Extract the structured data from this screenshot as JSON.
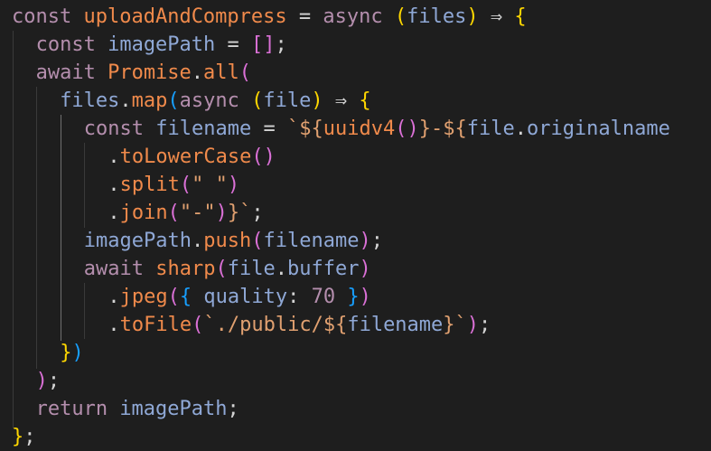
{
  "colors": {
    "background": "#1e1e1e",
    "keyword": "#b48ead",
    "function": "#f08a4b",
    "variable": "#8fa8d6",
    "punct": "#d4d4d4",
    "operator": "#d4d4d4",
    "brace_gold": "#ffd700",
    "brace_violet": "#da70d6",
    "brace_blue": "#179fff",
    "string": "#e0a070",
    "number": "#b48ead"
  },
  "code_lines": [
    [
      [
        "const ",
        "keyword"
      ],
      [
        "uploadAndCompress",
        "function"
      ],
      [
        " = ",
        "operator"
      ],
      [
        "async ",
        "keyword"
      ],
      [
        "(",
        "brace_gold"
      ],
      [
        "files",
        "variable"
      ],
      [
        ")",
        "brace_gold"
      ],
      [
        " ⇒ ",
        "operator"
      ],
      [
        "{",
        "brace_gold"
      ]
    ],
    [
      [
        "const ",
        "keyword"
      ],
      [
        "imagePath",
        "variable"
      ],
      [
        " = ",
        "operator"
      ],
      [
        "[]",
        "brace_violet"
      ],
      [
        ";",
        "punct"
      ]
    ],
    [
      [
        "await ",
        "keyword"
      ],
      [
        "Promise",
        "function"
      ],
      [
        ".",
        "punct"
      ],
      [
        "all",
        "function"
      ],
      [
        "(",
        "brace_violet"
      ]
    ],
    [
      [
        "files",
        "variable"
      ],
      [
        ".",
        "punct"
      ],
      [
        "map",
        "function"
      ],
      [
        "(",
        "brace_blue"
      ],
      [
        "async ",
        "keyword"
      ],
      [
        "(",
        "brace_gold"
      ],
      [
        "file",
        "variable"
      ],
      [
        ")",
        "brace_gold"
      ],
      [
        " ⇒ ",
        "operator"
      ],
      [
        "{",
        "brace_gold"
      ]
    ],
    [
      [
        "const ",
        "keyword"
      ],
      [
        "filename",
        "variable"
      ],
      [
        " = ",
        "operator"
      ],
      [
        "`${",
        "string"
      ],
      [
        "uuidv4",
        "function"
      ],
      [
        "()",
        "brace_violet"
      ],
      [
        "}-${",
        "string"
      ],
      [
        "file",
        "variable"
      ],
      [
        ".",
        "punct"
      ],
      [
        "originalname",
        "variable"
      ]
    ],
    [
      [
        ".",
        "punct"
      ],
      [
        "toLowerCase",
        "function"
      ],
      [
        "()",
        "brace_violet"
      ]
    ],
    [
      [
        ".",
        "punct"
      ],
      [
        "split",
        "function"
      ],
      [
        "(",
        "brace_violet"
      ],
      [
        "\" \"",
        "string"
      ],
      [
        ")",
        "brace_violet"
      ]
    ],
    [
      [
        ".",
        "punct"
      ],
      [
        "join",
        "function"
      ],
      [
        "(",
        "brace_violet"
      ],
      [
        "\"-\"",
        "string"
      ],
      [
        ")",
        "brace_violet"
      ],
      [
        "}`",
        "string"
      ],
      [
        ";",
        "punct"
      ]
    ],
    [
      [
        "imagePath",
        "variable"
      ],
      [
        ".",
        "punct"
      ],
      [
        "push",
        "function"
      ],
      [
        "(",
        "brace_violet"
      ],
      [
        "filename",
        "variable"
      ],
      [
        ")",
        "brace_violet"
      ],
      [
        ";",
        "punct"
      ]
    ],
    [
      [
        "await ",
        "keyword"
      ],
      [
        "sharp",
        "function"
      ],
      [
        "(",
        "brace_violet"
      ],
      [
        "file",
        "variable"
      ],
      [
        ".",
        "punct"
      ],
      [
        "buffer",
        "variable"
      ],
      [
        ")",
        "brace_violet"
      ]
    ],
    [
      [
        ".",
        "punct"
      ],
      [
        "jpeg",
        "function"
      ],
      [
        "(",
        "brace_violet"
      ],
      [
        "{ ",
        "brace_blue"
      ],
      [
        "quality",
        "variable"
      ],
      [
        ": ",
        "punct"
      ],
      [
        "70",
        "number"
      ],
      [
        " }",
        "brace_blue"
      ],
      [
        ")",
        "brace_violet"
      ]
    ],
    [
      [
        ".",
        "punct"
      ],
      [
        "toFile",
        "function"
      ],
      [
        "(",
        "brace_violet"
      ],
      [
        "`./public/${",
        "string"
      ],
      [
        "filename",
        "variable"
      ],
      [
        "}`",
        "string"
      ],
      [
        ")",
        "brace_violet"
      ],
      [
        ";",
        "punct"
      ]
    ],
    [
      [
        "}",
        "brace_gold"
      ],
      [
        ")",
        "brace_blue"
      ]
    ],
    [
      [
        ")",
        "brace_violet"
      ],
      [
        ";",
        "punct"
      ]
    ],
    [
      [
        "return ",
        "keyword"
      ],
      [
        "imagePath",
        "variable"
      ],
      [
        ";",
        "punct"
      ]
    ],
    [
      [
        "}",
        "brace_gold"
      ],
      [
        ";",
        "punct"
      ]
    ]
  ]
}
